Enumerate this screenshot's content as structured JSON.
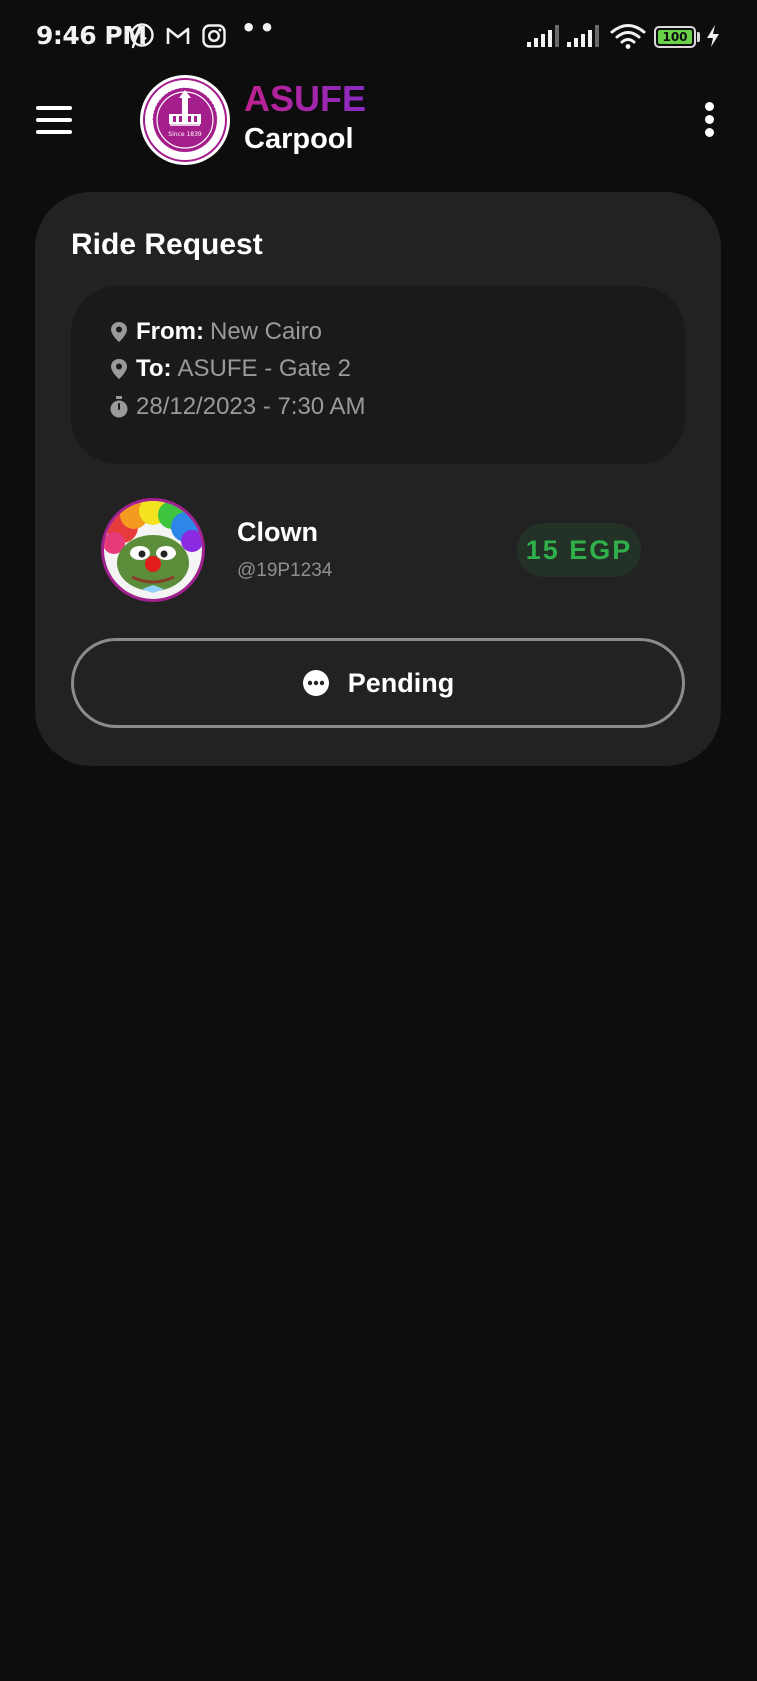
{
  "status_bar": {
    "time": "9:46 PM",
    "notification_icons": [
      "whatsapp-icon",
      "gmail-icon",
      "instagram-icon"
    ],
    "more_notifications": "••",
    "battery_level": "100"
  },
  "header": {
    "brand_title": "ASUFE",
    "brand_subtitle": "Carpool",
    "logo_text": "Since 1839",
    "colors": {
      "brand_gradient_start": "#c0208f",
      "brand_gradient_end": "#8a2bc2"
    }
  },
  "card": {
    "title": "Ride Request",
    "trip": {
      "from_label": "From:",
      "from_value": "New Cairo",
      "to_label": "To:",
      "to_value": "ASUFE - Gate 2",
      "datetime": "28/12/2023 - 7:30 AM"
    },
    "passenger": {
      "name": "Clown",
      "handle": "@19P1234"
    },
    "price": "15 EGP",
    "status_button": {
      "label": "Pending",
      "icon": "more-horizontal-circle-icon"
    },
    "colors": {
      "price_text": "#2fb04a",
      "price_bg": "#233126",
      "card_bg": "#222223"
    }
  }
}
